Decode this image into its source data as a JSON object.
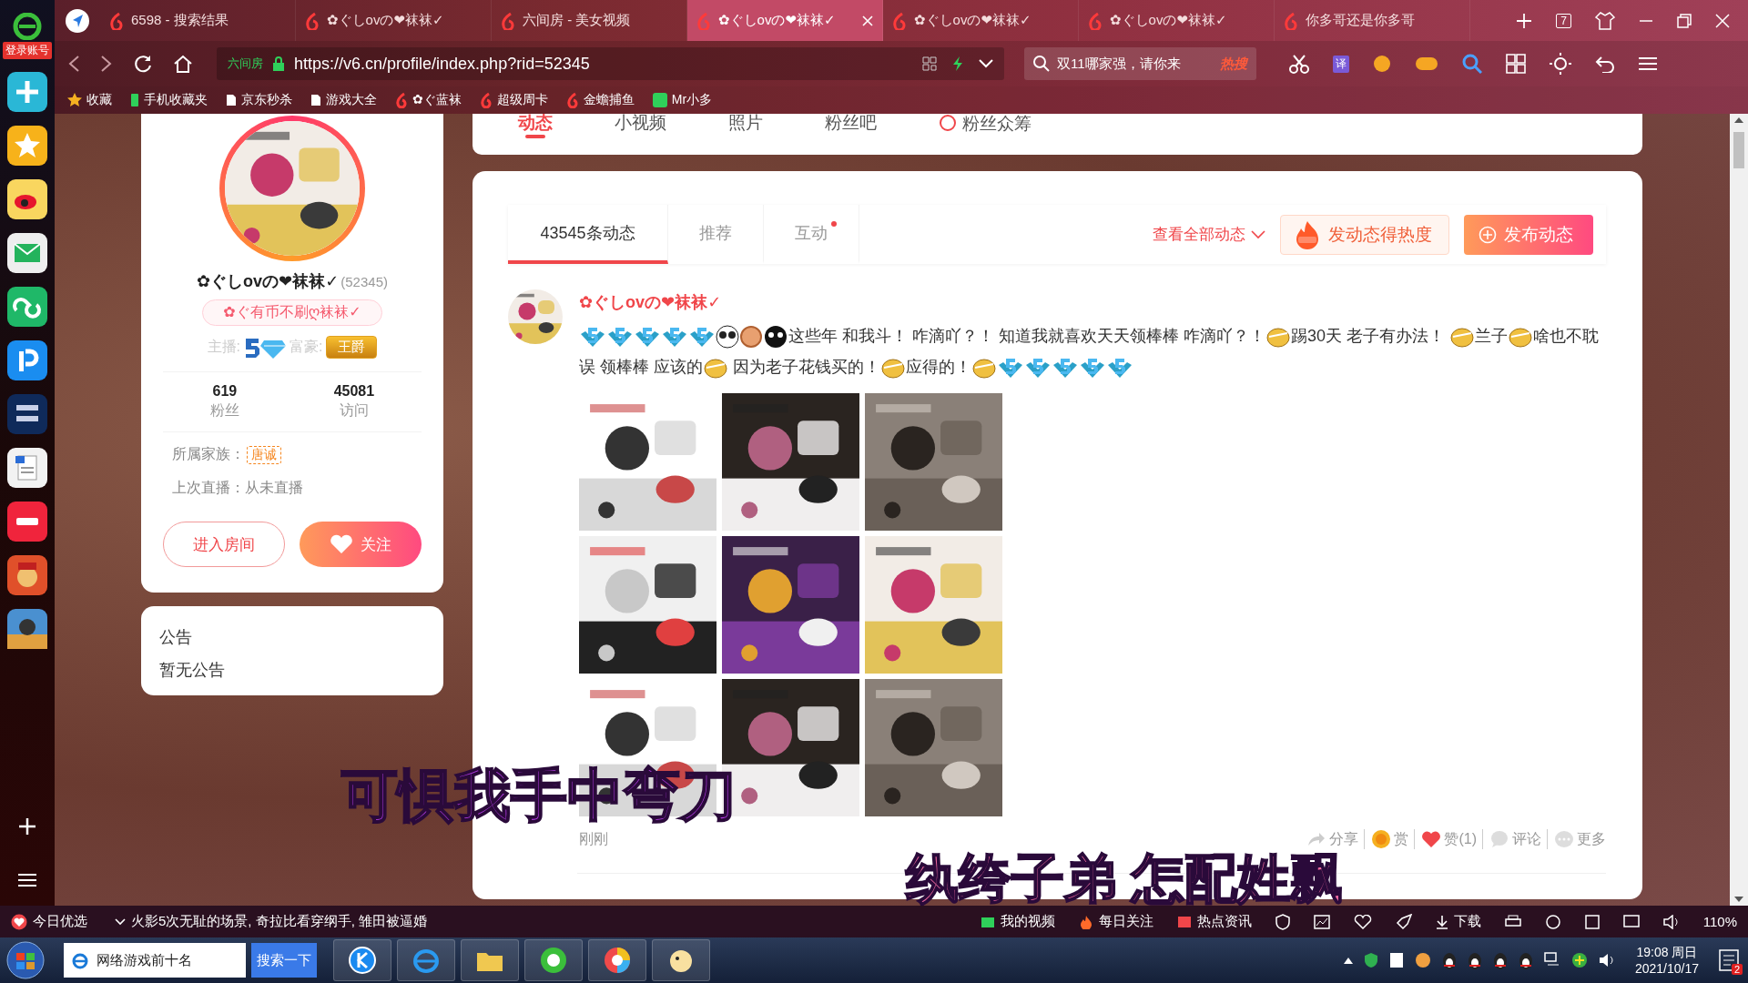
{
  "browser": {
    "tabs": [
      {
        "title": "6598 - 搜索结果",
        "selected": false
      },
      {
        "title": "✿ぐしovの❤袜袜✓",
        "selected": false
      },
      {
        "title": "六间房 - 美女视频",
        "selected": false
      },
      {
        "title": "✿ぐしovの❤袜袜✓",
        "selected": true
      },
      {
        "title": "✿ぐしovの❤袜袜✓",
        "selected": false
      },
      {
        "title": "✿ぐしovの❤袜袜✓",
        "selected": false
      },
      {
        "title": "你多哥还是你多哥",
        "selected": false
      }
    ],
    "tab_count": "7",
    "site_label": "六间房",
    "url": "https://v6.cn/profile/index.php?rid=52345",
    "search": {
      "value": "双11哪家强，请你来",
      "hot": "热搜"
    },
    "translate": "译",
    "bookmarks": [
      "收藏",
      "手机收藏夹",
      "京东秒杀",
      "游戏大全",
      "✿ぐ蓝袜",
      "超级周卡",
      "金蟾捕鱼",
      "Mr小多"
    ]
  },
  "dock": {
    "login": "登录账号"
  },
  "nav_tabs": [
    {
      "label": "动态",
      "selected": true
    },
    {
      "label": "小视频",
      "selected": false
    },
    {
      "label": "照片",
      "selected": false
    },
    {
      "label": "粉丝吧",
      "selected": false
    },
    {
      "label": "粉丝众筹",
      "selected": false
    }
  ],
  "profile": {
    "name": "✿ぐしovの❤袜袜✓",
    "rid": "(52345)",
    "signature": "✿ぐ有币不刷ღ袜袜✓",
    "host_label": "主播:",
    "wealth_label": "富豪:",
    "wealth_badge": "王爵",
    "stats": [
      {
        "value": "619",
        "label": "粉丝"
      },
      {
        "value": "45081",
        "label": "访问"
      }
    ],
    "family_label": "所属家族：",
    "family": "唐诚",
    "last_live": "上次直播：从未直播",
    "enter": "进入房间",
    "follow": "关注"
  },
  "notice": {
    "title": "公告",
    "body": "暂无公告"
  },
  "feed": {
    "tabs": [
      {
        "label": "43545条动态",
        "selected": true,
        "dot": false
      },
      {
        "label": "推荐",
        "selected": false,
        "dot": false
      },
      {
        "label": "互动",
        "selected": false,
        "dot": true
      }
    ],
    "view_all": "查看全部动态",
    "hot_button": "发动态得热度",
    "publish": "发布动态",
    "post": {
      "author": "✿ぐしovの❤袜袜✓",
      "content": [
        {
          "kind": "badge"
        },
        {
          "kind": "badge"
        },
        {
          "kind": "badge"
        },
        {
          "kind": "badge"
        },
        {
          "kind": "badge"
        },
        {
          "kind": "panda"
        },
        {
          "kind": "medal"
        },
        {
          "kind": "face"
        },
        {
          "kind": "text",
          "text": "这些年 和我斗！ 咋滴吖？！ 知道我就喜欢天天领棒棒 咋滴吖？！"
        },
        {
          "kind": "bang"
        },
        {
          "kind": "text",
          "text": "踢30天 老子有办法！ "
        },
        {
          "kind": "bang"
        },
        {
          "kind": "text",
          "text": "兰子"
        },
        {
          "kind": "bang"
        },
        {
          "kind": "text",
          "text": "啥也不耽误 领棒棒 应该的"
        },
        {
          "kind": "bang"
        },
        {
          "kind": "text",
          "text": " 因为老子花钱买的！"
        },
        {
          "kind": "bang"
        },
        {
          "kind": "text",
          "text": "应得的！"
        },
        {
          "kind": "bang"
        },
        {
          "kind": "badge"
        },
        {
          "kind": "badge"
        },
        {
          "kind": "badge"
        },
        {
          "kind": "badge"
        },
        {
          "kind": "badge"
        }
      ],
      "time": "刚刚",
      "actions": [
        {
          "kind": "share",
          "label": "分享"
        },
        {
          "kind": "reward",
          "label": "赏"
        },
        {
          "kind": "like",
          "label": "赞(1)"
        },
        {
          "kind": "comment",
          "label": "评论"
        },
        {
          "kind": "more",
          "label": "更多"
        }
      ]
    }
  },
  "captions": [
    "可惧我手中弯刀",
    "纨绔子弟  怎配姓飘"
  ],
  "status_bar": {
    "today": "今日优选",
    "news": "火影5次无耻的场景, 奇拉比看穿纲手, 雏田被逼婚",
    "links": [
      "我的视频",
      "每日关注",
      "热点资讯"
    ],
    "download": "下载",
    "zoom": "110%"
  },
  "taskbar": {
    "search": "网络游戏前十名",
    "search_button": "搜索一下",
    "time": "19:08 周日",
    "date": "2021/10/17",
    "badge": "2"
  }
}
